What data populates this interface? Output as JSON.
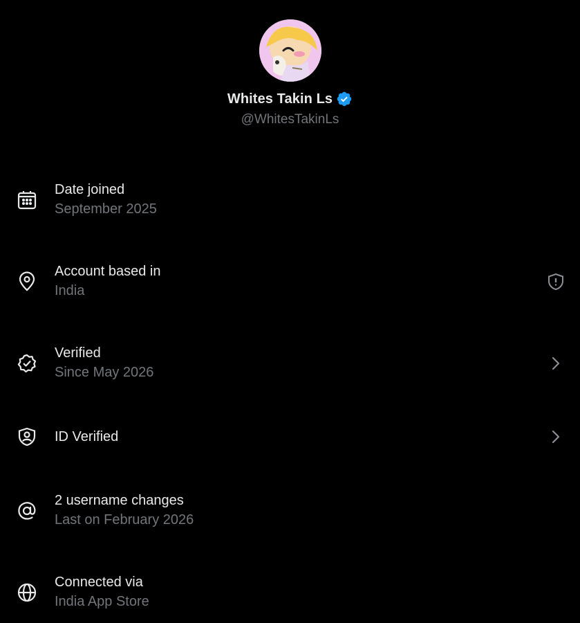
{
  "profile": {
    "display_name": "Whites Takin Ls",
    "handle": "@WhitesTakinLs",
    "verified": true,
    "badge_color": "#1d9bf0"
  },
  "rows": [
    {
      "icon": "calendar-icon",
      "title": "Date joined",
      "subtitle": "September 2025"
    },
    {
      "icon": "location-pin-icon",
      "title": "Account based in",
      "subtitle": "India",
      "trailing_icon": "shield-alert-icon"
    },
    {
      "icon": "verified-badge-icon",
      "title": "Verified",
      "subtitle": "Since May 2026",
      "trailing_icon": "chevron-right-icon"
    },
    {
      "icon": "id-shield-icon",
      "title": "ID Verified",
      "trailing_icon": "chevron-right-icon"
    },
    {
      "icon": "at-sign-icon",
      "title": "2 username changes",
      "subtitle": "Last on February 2026"
    },
    {
      "icon": "globe-icon",
      "title": "Connected via",
      "subtitle": "India App Store"
    }
  ],
  "colors": {
    "background": "#000000",
    "primary_text": "#e7e9ea",
    "secondary_text": "#71767b",
    "accent": "#1d9bf0"
  }
}
